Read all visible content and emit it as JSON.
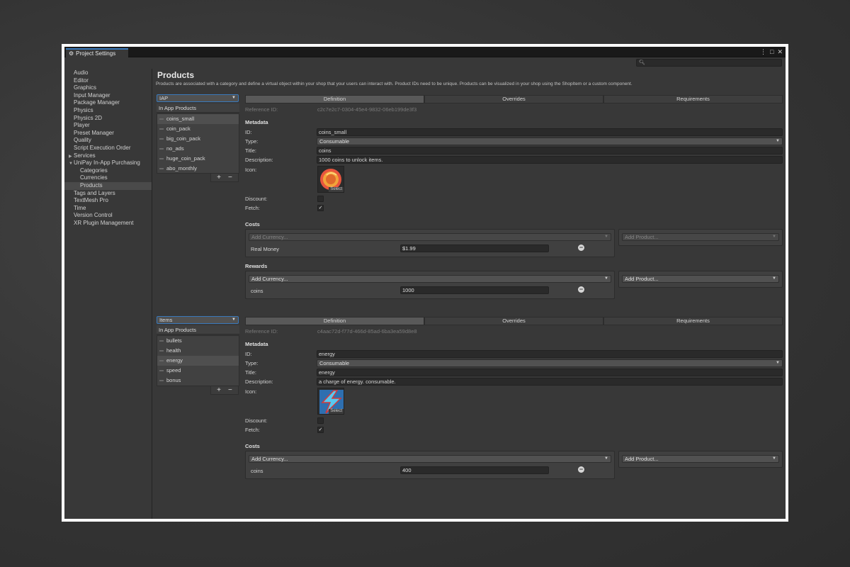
{
  "window": {
    "tab_title": "Project Settings",
    "search_placeholder": ""
  },
  "sidebar": {
    "items": [
      {
        "label": "Audio"
      },
      {
        "label": "Editor"
      },
      {
        "label": "Graphics"
      },
      {
        "label": "Input Manager"
      },
      {
        "label": "Package Manager"
      },
      {
        "label": "Physics"
      },
      {
        "label": "Physics 2D"
      },
      {
        "label": "Player"
      },
      {
        "label": "Preset Manager"
      },
      {
        "label": "Quality"
      },
      {
        "label": "Script Execution Order"
      },
      {
        "label": "Services"
      },
      {
        "label": "UniPay In-App Purchasing"
      },
      {
        "label": "Categories"
      },
      {
        "label": "Currencies"
      },
      {
        "label": "Products"
      },
      {
        "label": "Tags and Layers"
      },
      {
        "label": "TextMesh Pro"
      },
      {
        "label": "Time"
      },
      {
        "label": "Version Control"
      },
      {
        "label": "XR Plugin Management"
      }
    ]
  },
  "page": {
    "title": "Products",
    "description": "Products are associated with a category and define a virtual object within your shop that your users can interact with. Product IDs need to be unique. Products can be visualized in your shop using the ShopItem or a custom component."
  },
  "tabs": [
    "Definition",
    "Overrides",
    "Requirements"
  ],
  "labels": {
    "reference_id": "Reference ID:",
    "metadata": "Metadata",
    "id": "ID:",
    "type": "Type:",
    "title": "Title:",
    "description": "Description:",
    "icon": "Icon:",
    "discount": "Discount:",
    "fetch": "Fetch:",
    "costs": "Costs",
    "rewards": "Rewards",
    "select": "Select",
    "add_currency": "Add Currency...",
    "add_product": "Add Product...",
    "list_header": "In App Products",
    "plus": "+",
    "minus": "−"
  },
  "section1": {
    "category": "IAP",
    "products": [
      "coins_small",
      "coin_pack",
      "big_coin_pack",
      "no_ads",
      "huge_coin_pack",
      "abo_monthly"
    ],
    "reference_id": "c2c7e2c7-0304-45e4-9832-06eb199de3f3",
    "id": "coins_small",
    "type": "Consumable",
    "title": "coins",
    "description": "1000 coins to unlock items.",
    "fetch": true,
    "discount": false,
    "costs": [
      {
        "name": "Real Money",
        "value": "$1.99"
      }
    ],
    "rewards": [
      {
        "name": "coins",
        "value": "1000"
      }
    ]
  },
  "section2": {
    "category": "Items",
    "products": [
      "bullets",
      "health",
      "energy",
      "speed",
      "bonus"
    ],
    "reference_id": "c4aac72d-f77d-466d-85ad-6ba3ea59d8e8",
    "id": "energy",
    "type": "Consumable",
    "title": "energy",
    "description": "a charge of energy. consumable.",
    "fetch": true,
    "discount": false,
    "costs": [
      {
        "name": "coins",
        "value": "400"
      }
    ]
  },
  "colors": {
    "accent": "#3a79bb",
    "background": "#383838",
    "field": "#2a2a2a"
  }
}
